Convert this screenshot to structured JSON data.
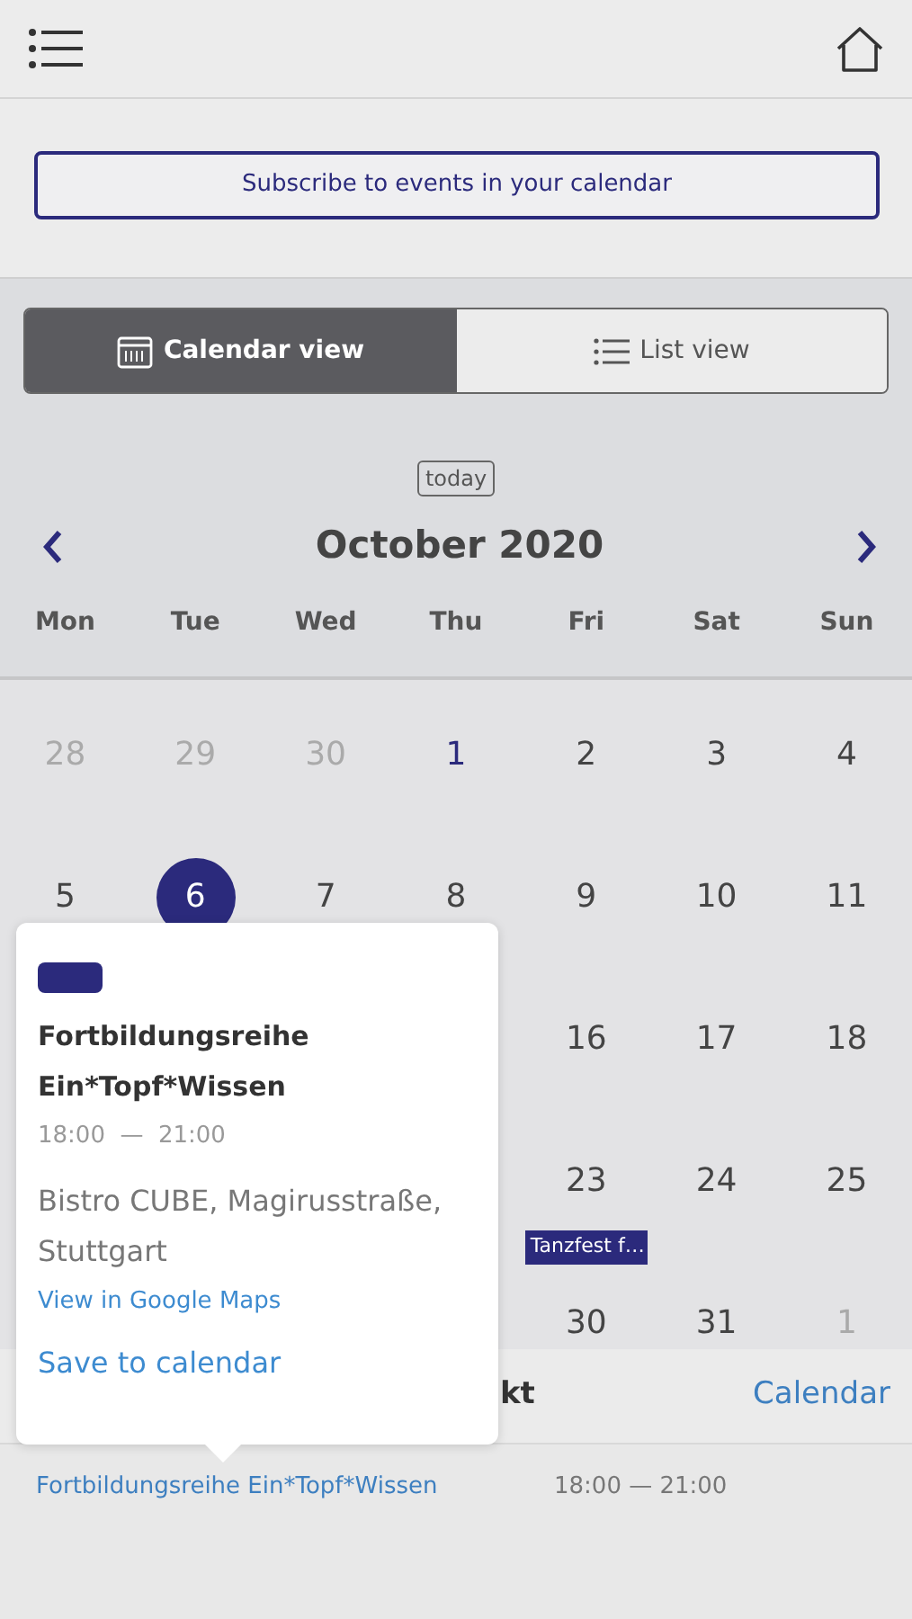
{
  "subscribe_button": "Subscribe to events in your calendar",
  "view_tabs": [
    {
      "label": "Calendar view",
      "kind": "calendar",
      "selected": true
    },
    {
      "label": "List view",
      "kind": "list",
      "selected": false
    }
  ],
  "today_button": "today",
  "month_title": "October 2020",
  "weekdays": [
    "Mon",
    "Tue",
    "Wed",
    "Thu",
    "Fri",
    "Sat",
    "Sun"
  ],
  "weeks": [
    [
      {
        "day": "28",
        "muted": true,
        "accent": false,
        "selected": false
      },
      {
        "day": "29",
        "muted": true,
        "accent": false,
        "selected": false
      },
      {
        "day": "30",
        "muted": true,
        "accent": false,
        "selected": false
      },
      {
        "day": "1",
        "muted": false,
        "accent": true,
        "selected": false
      },
      {
        "day": "2",
        "muted": false,
        "accent": false,
        "selected": false
      },
      {
        "day": "3",
        "muted": false,
        "accent": false,
        "selected": false
      },
      {
        "day": "4",
        "muted": false,
        "accent": false,
        "selected": false
      }
    ],
    [
      {
        "day": "5",
        "muted": false,
        "accent": false,
        "selected": false
      },
      {
        "day": "6",
        "muted": false,
        "accent": false,
        "selected": true
      },
      {
        "day": "7",
        "muted": false,
        "accent": false,
        "selected": false
      },
      {
        "day": "8",
        "muted": false,
        "accent": false,
        "selected": false
      },
      {
        "day": "9",
        "muted": false,
        "accent": false,
        "selected": false
      },
      {
        "day": "10",
        "muted": false,
        "accent": false,
        "selected": false
      },
      {
        "day": "11",
        "muted": false,
        "accent": false,
        "selected": false
      }
    ],
    [
      {
        "day": "16",
        "muted": false,
        "accent": false,
        "selected": false
      },
      {
        "day": "17",
        "muted": false,
        "accent": false,
        "selected": false
      },
      {
        "day": "18",
        "muted": false,
        "accent": false,
        "selected": false
      }
    ],
    [
      {
        "day": "23",
        "muted": false,
        "accent": false,
        "selected": false,
        "events": [
          {
            "title": "Tanzfest f…",
            "color": "#2b2a7c"
          }
        ]
      },
      {
        "day": "24",
        "muted": false,
        "accent": false,
        "selected": false
      },
      {
        "day": "25",
        "muted": false,
        "accent": false,
        "selected": false
      }
    ],
    [
      {
        "day": "30",
        "muted": false,
        "accent": false,
        "selected": false
      },
      {
        "day": "31",
        "muted": false,
        "accent": false,
        "selected": false
      },
      {
        "day": "1",
        "muted": true,
        "accent": false,
        "selected": false
      }
    ]
  ],
  "popover": {
    "color": "#2b2a7c",
    "title": "Fortbildungsreihe Ein*Topf*Wissen",
    "time": "18:00  —  21:00",
    "location": "Bistro CUBE, Magirusstraße, Stuttgart",
    "maps_link": "View in Google Maps",
    "save_link": "Save to calendar"
  },
  "list": {
    "column_1": "kt",
    "calendar_link": "Calendar",
    "rows": [
      {
        "title": "Fortbildungsreihe Ein*Topf*Wissen",
        "time": "18:00 — 21:00"
      }
    ]
  }
}
